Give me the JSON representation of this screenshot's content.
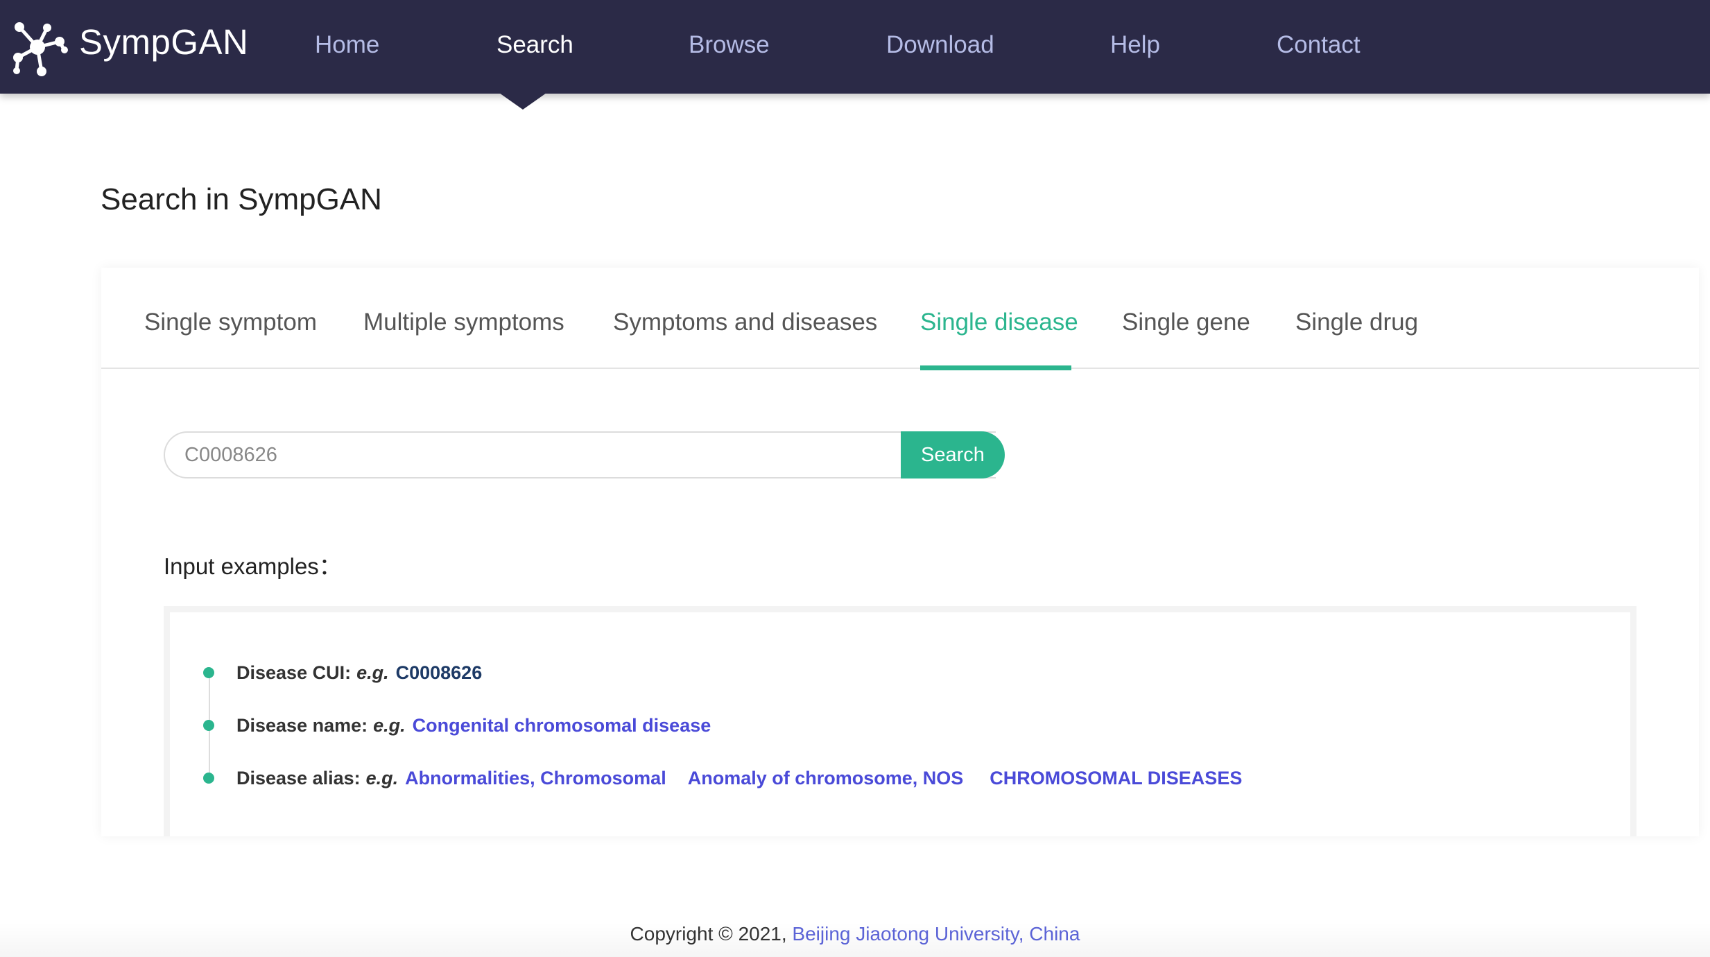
{
  "brand": {
    "name": "SympGAN",
    "logo_icon": "network-nodes-icon"
  },
  "nav": {
    "items": [
      {
        "label": "Home",
        "active": false
      },
      {
        "label": "Search",
        "active": true
      },
      {
        "label": "Browse",
        "active": false
      },
      {
        "label": "Download",
        "active": false
      },
      {
        "label": "Help",
        "active": false
      },
      {
        "label": "Contact",
        "active": false
      }
    ]
  },
  "page": {
    "title": "Search in SympGAN"
  },
  "tabs": [
    {
      "label": "Single symptom",
      "active": false
    },
    {
      "label": "Multiple symptoms",
      "active": false
    },
    {
      "label": "Symptoms and diseases",
      "active": false
    },
    {
      "label": "Single disease",
      "active": true
    },
    {
      "label": "Single gene",
      "active": false
    },
    {
      "label": "Single drug",
      "active": false
    }
  ],
  "search": {
    "placeholder": "C0008626",
    "value": "",
    "button_label": "Search"
  },
  "examples": {
    "title": "Input examples：",
    "eg": "e.g.",
    "cui": {
      "label": "Disease CUI:",
      "values": [
        "C0008626"
      ]
    },
    "name": {
      "label": "Disease name:",
      "values": [
        "Congenital chromosomal disease"
      ]
    },
    "alias": {
      "label": "Disease alias:",
      "values": [
        "Abnormalities, Chromosomal",
        "Anomaly of chromosome, NOS",
        "CHROMOSOMAL DISEASES"
      ]
    }
  },
  "footer": {
    "text": "Copyright © 2021, ",
    "link": "Beijing Jiaotong University, China"
  },
  "colors": {
    "nav_bg": "#2b2a47",
    "accent": "#2bb58e",
    "link": "#4a4ad8",
    "nav_text": "#b5bce6"
  }
}
